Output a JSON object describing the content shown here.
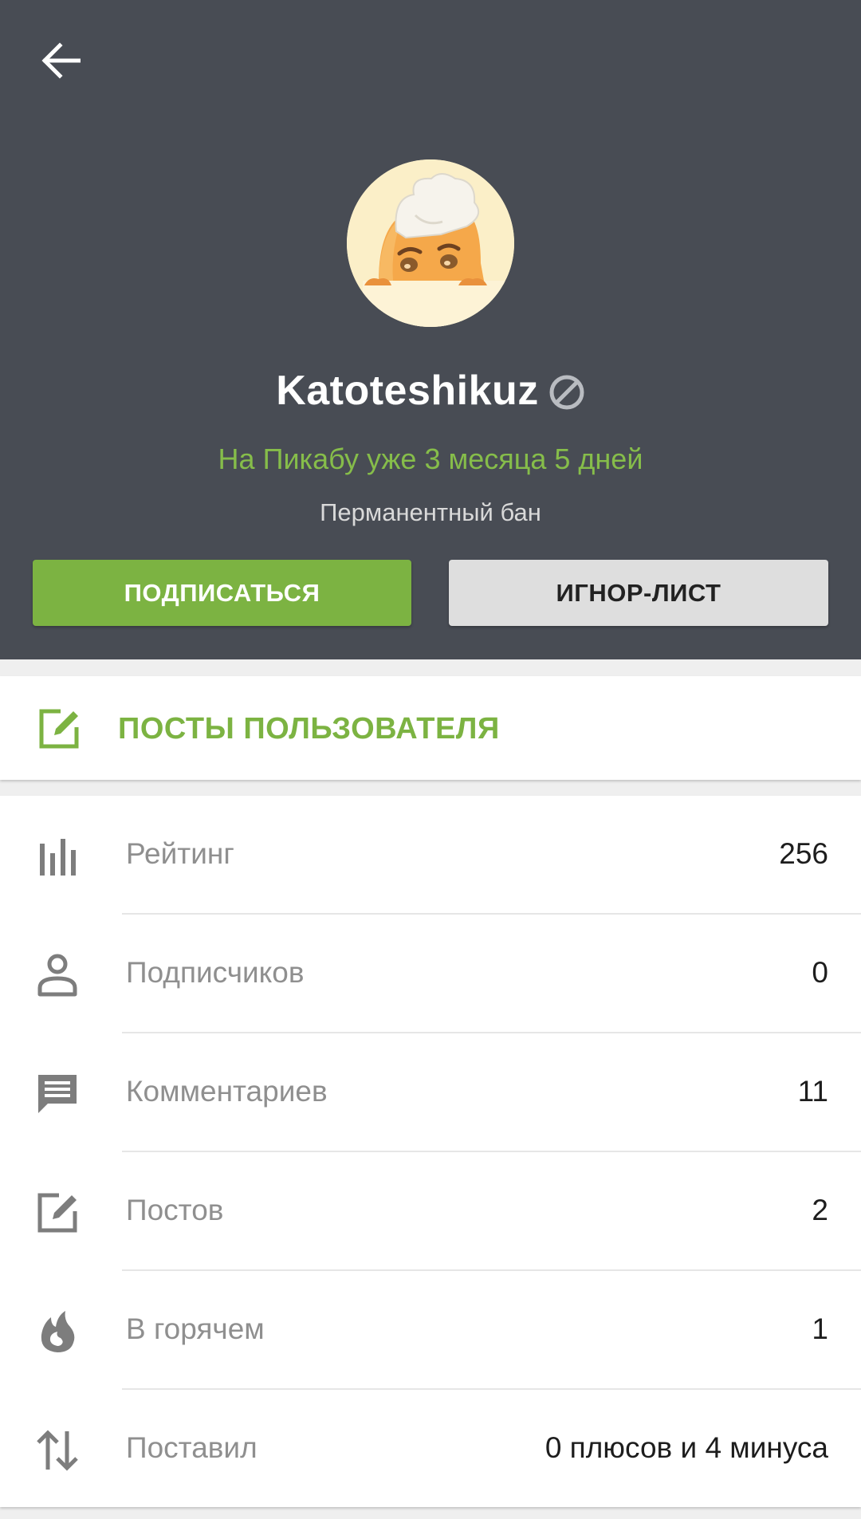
{
  "header": {
    "back_icon": "arrow-left-icon",
    "username": "Katoteshikuz",
    "banned_icon": "ban-icon",
    "since": "На Пикабу уже 3 месяца 5 дней",
    "ban_status": "Перманентный бан",
    "subscribe_label": "ПОДПИСАТЬСЯ",
    "ignore_label": "ИГНОР-ЛИСТ"
  },
  "posts_link": {
    "icon": "edit-icon",
    "label": "ПОСТЫ ПОЛЬЗОВАТЕЛЯ"
  },
  "stats": [
    {
      "icon": "bar-chart-icon",
      "label": "Рейтинг",
      "value": "256"
    },
    {
      "icon": "person-icon",
      "label": "Подписчиков",
      "value": "0"
    },
    {
      "icon": "comment-icon",
      "label": "Комментариев",
      "value": "11"
    },
    {
      "icon": "edit-icon",
      "label": "Постов",
      "value": "2"
    },
    {
      "icon": "flame-icon",
      "label": "В горячем",
      "value": "1"
    },
    {
      "icon": "swap-vertical-icon",
      "label": "Поставил",
      "value": "0 плюсов и 4 минуса"
    }
  ],
  "colors": {
    "header_bg": "#484c54",
    "accent_green": "#7cb342",
    "since_green": "#86bd4a",
    "page_bg": "#efefef"
  }
}
